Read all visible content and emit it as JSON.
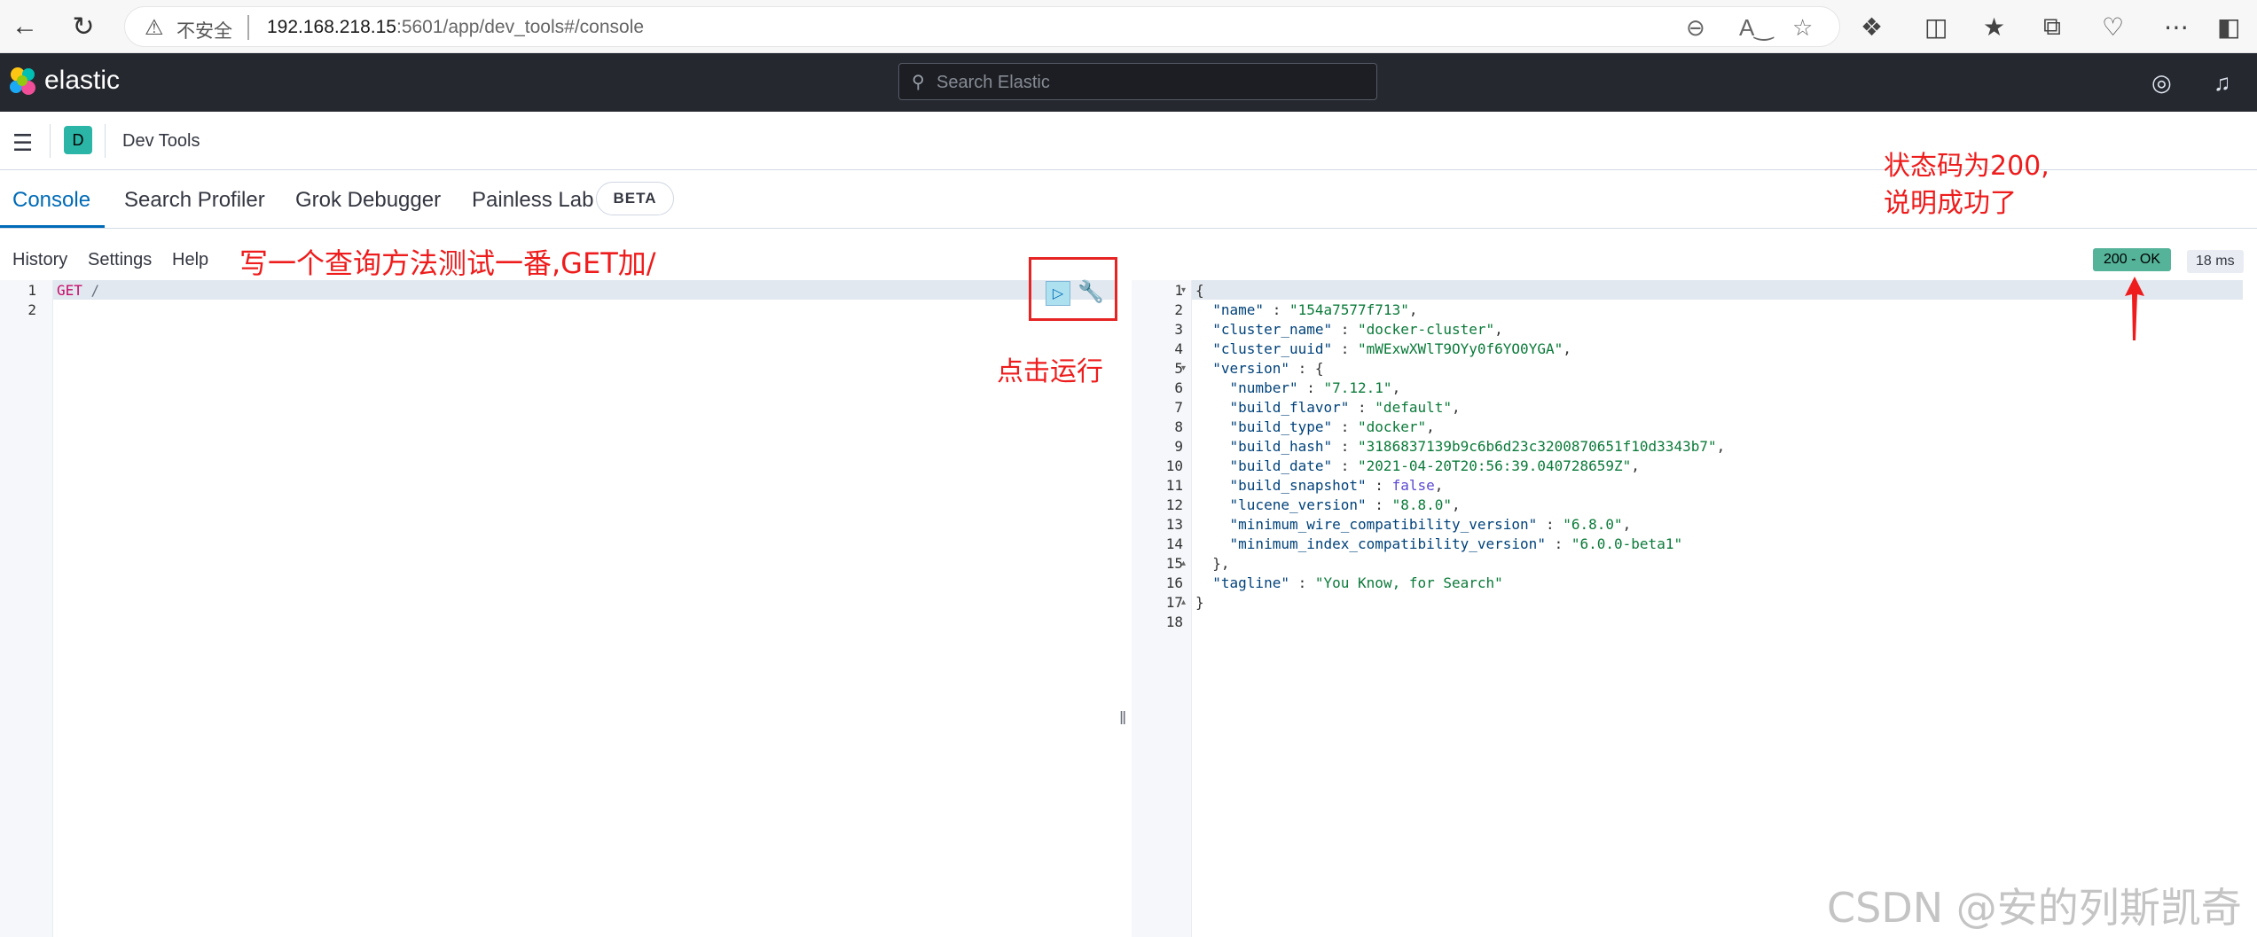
{
  "browser": {
    "security_label": "不安全",
    "url_host": "192.168.218.15",
    "url_path": ":5601/app/dev_tools#/console"
  },
  "kibana": {
    "brand": "elastic",
    "search_placeholder": "Search Elastic",
    "app_badge": "D",
    "app_title": "Dev Tools"
  },
  "tabs": [
    {
      "label": "Console",
      "active": true
    },
    {
      "label": "Search Profiler"
    },
    {
      "label": "Grok Debugger"
    },
    {
      "label": "Painless Lab"
    }
  ],
  "beta_label": "BETA",
  "console_menu": [
    "History",
    "Settings",
    "Help"
  ],
  "editor": {
    "line_numbers": [
      "1",
      "2"
    ],
    "method": "GET",
    "path": "/"
  },
  "response": {
    "status": "200 - OK",
    "timing": "18 ms",
    "line_numbers": [
      "1",
      "2",
      "3",
      "4",
      "5",
      "6",
      "7",
      "8",
      "9",
      "10",
      "11",
      "12",
      "13",
      "14",
      "15",
      "16",
      "17",
      "18"
    ],
    "lines": [
      "{",
      "  \"name\" : \"154a7577f713\",",
      "  \"cluster_name\" : \"docker-cluster\",",
      "  \"cluster_uuid\" : \"mWExwXWlT9OYy0f6YO0YGA\",",
      "  \"version\" : {",
      "    \"number\" : \"7.12.1\",",
      "    \"build_flavor\" : \"default\",",
      "    \"build_type\" : \"docker\",",
      "    \"build_hash\" : \"3186837139b9c6b6d23c3200870651f10d3343b7\",",
      "    \"build_date\" : \"2021-04-20T20:56:39.040728659Z\",",
      "    \"build_snapshot\" : false,",
      "    \"lucene_version\" : \"8.8.0\",",
      "    \"minimum_wire_compatibility_version\" : \"6.8.0\",",
      "    \"minimum_index_compatibility_version\" : \"6.0.0-beta1\"",
      "  },",
      "  \"tagline\" : \"You Know, for Search\"",
      "}",
      ""
    ]
  },
  "annotations": {
    "query_hint": "写一个查询方法测试一番,GET加/",
    "run_hint": "点击运行",
    "status_hint_line1": "状态码为200,",
    "status_hint_line2": "说明成功了"
  },
  "watermark": "CSDN @安的列斯凯奇",
  "colors": {
    "header_bg": "#25282f",
    "accent": "#006bb8",
    "status_ok": "#54b399",
    "annotation_red": "#ee1c1c"
  }
}
